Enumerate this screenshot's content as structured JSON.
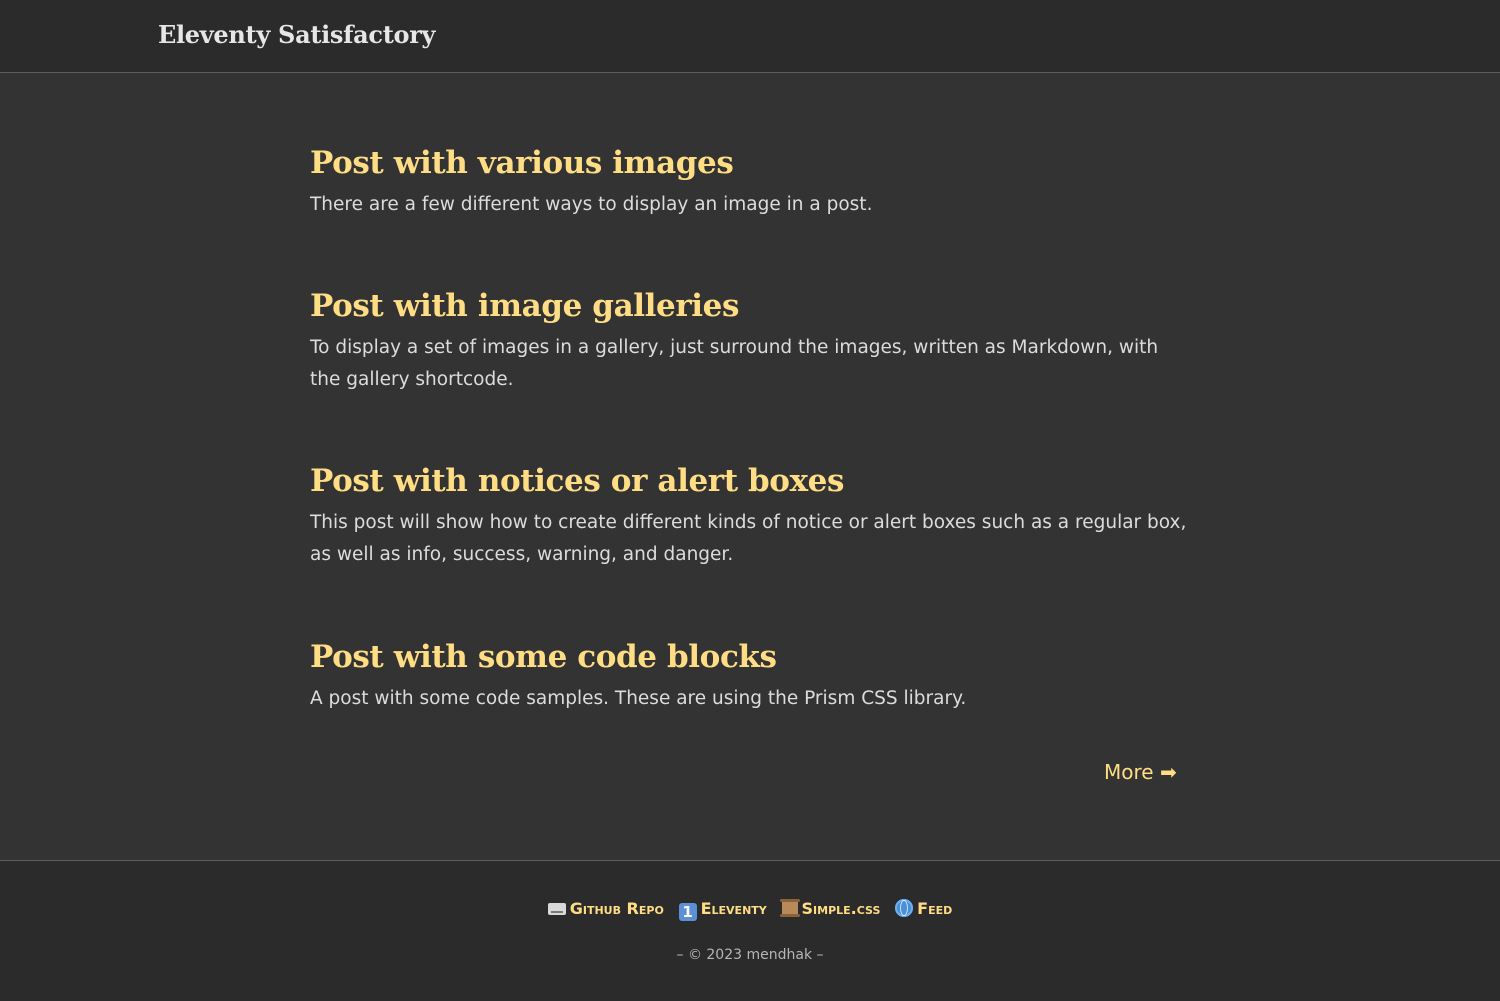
{
  "header": {
    "site_title": "Eleventy Satisfactory"
  },
  "posts": [
    {
      "title": "Post with various images",
      "description": "There are a few different ways to display an image in a post."
    },
    {
      "title": "Post with image galleries",
      "description": "To display a set of images in a gallery, just surround the images, written as Markdown, with the gallery shortcode."
    },
    {
      "title": "Post with notices or alert boxes",
      "description": "This post will show how to create different kinds of notice or alert boxes such as a regular box, as well as info, success, warning, and danger."
    },
    {
      "title": "Post with some code blocks",
      "description": "A post with some code samples. These are using the Prism CSS library."
    }
  ],
  "more_link": "More ➡",
  "footer": {
    "links": [
      {
        "icon": "keyboard-icon",
        "label": "Github Repo"
      },
      {
        "icon": "keycap-one-icon",
        "label": "Eleventy"
      },
      {
        "icon": "scroll-icon",
        "label": "Simple.css"
      },
      {
        "icon": "globe-icon",
        "label": "Feed"
      }
    ],
    "copyright": "– © 2023 mendhak –"
  },
  "colors": {
    "background": "#333333",
    "header_footer": "#2b2b2b",
    "accent": "#ffdd85",
    "text": "#dcdcdc"
  }
}
